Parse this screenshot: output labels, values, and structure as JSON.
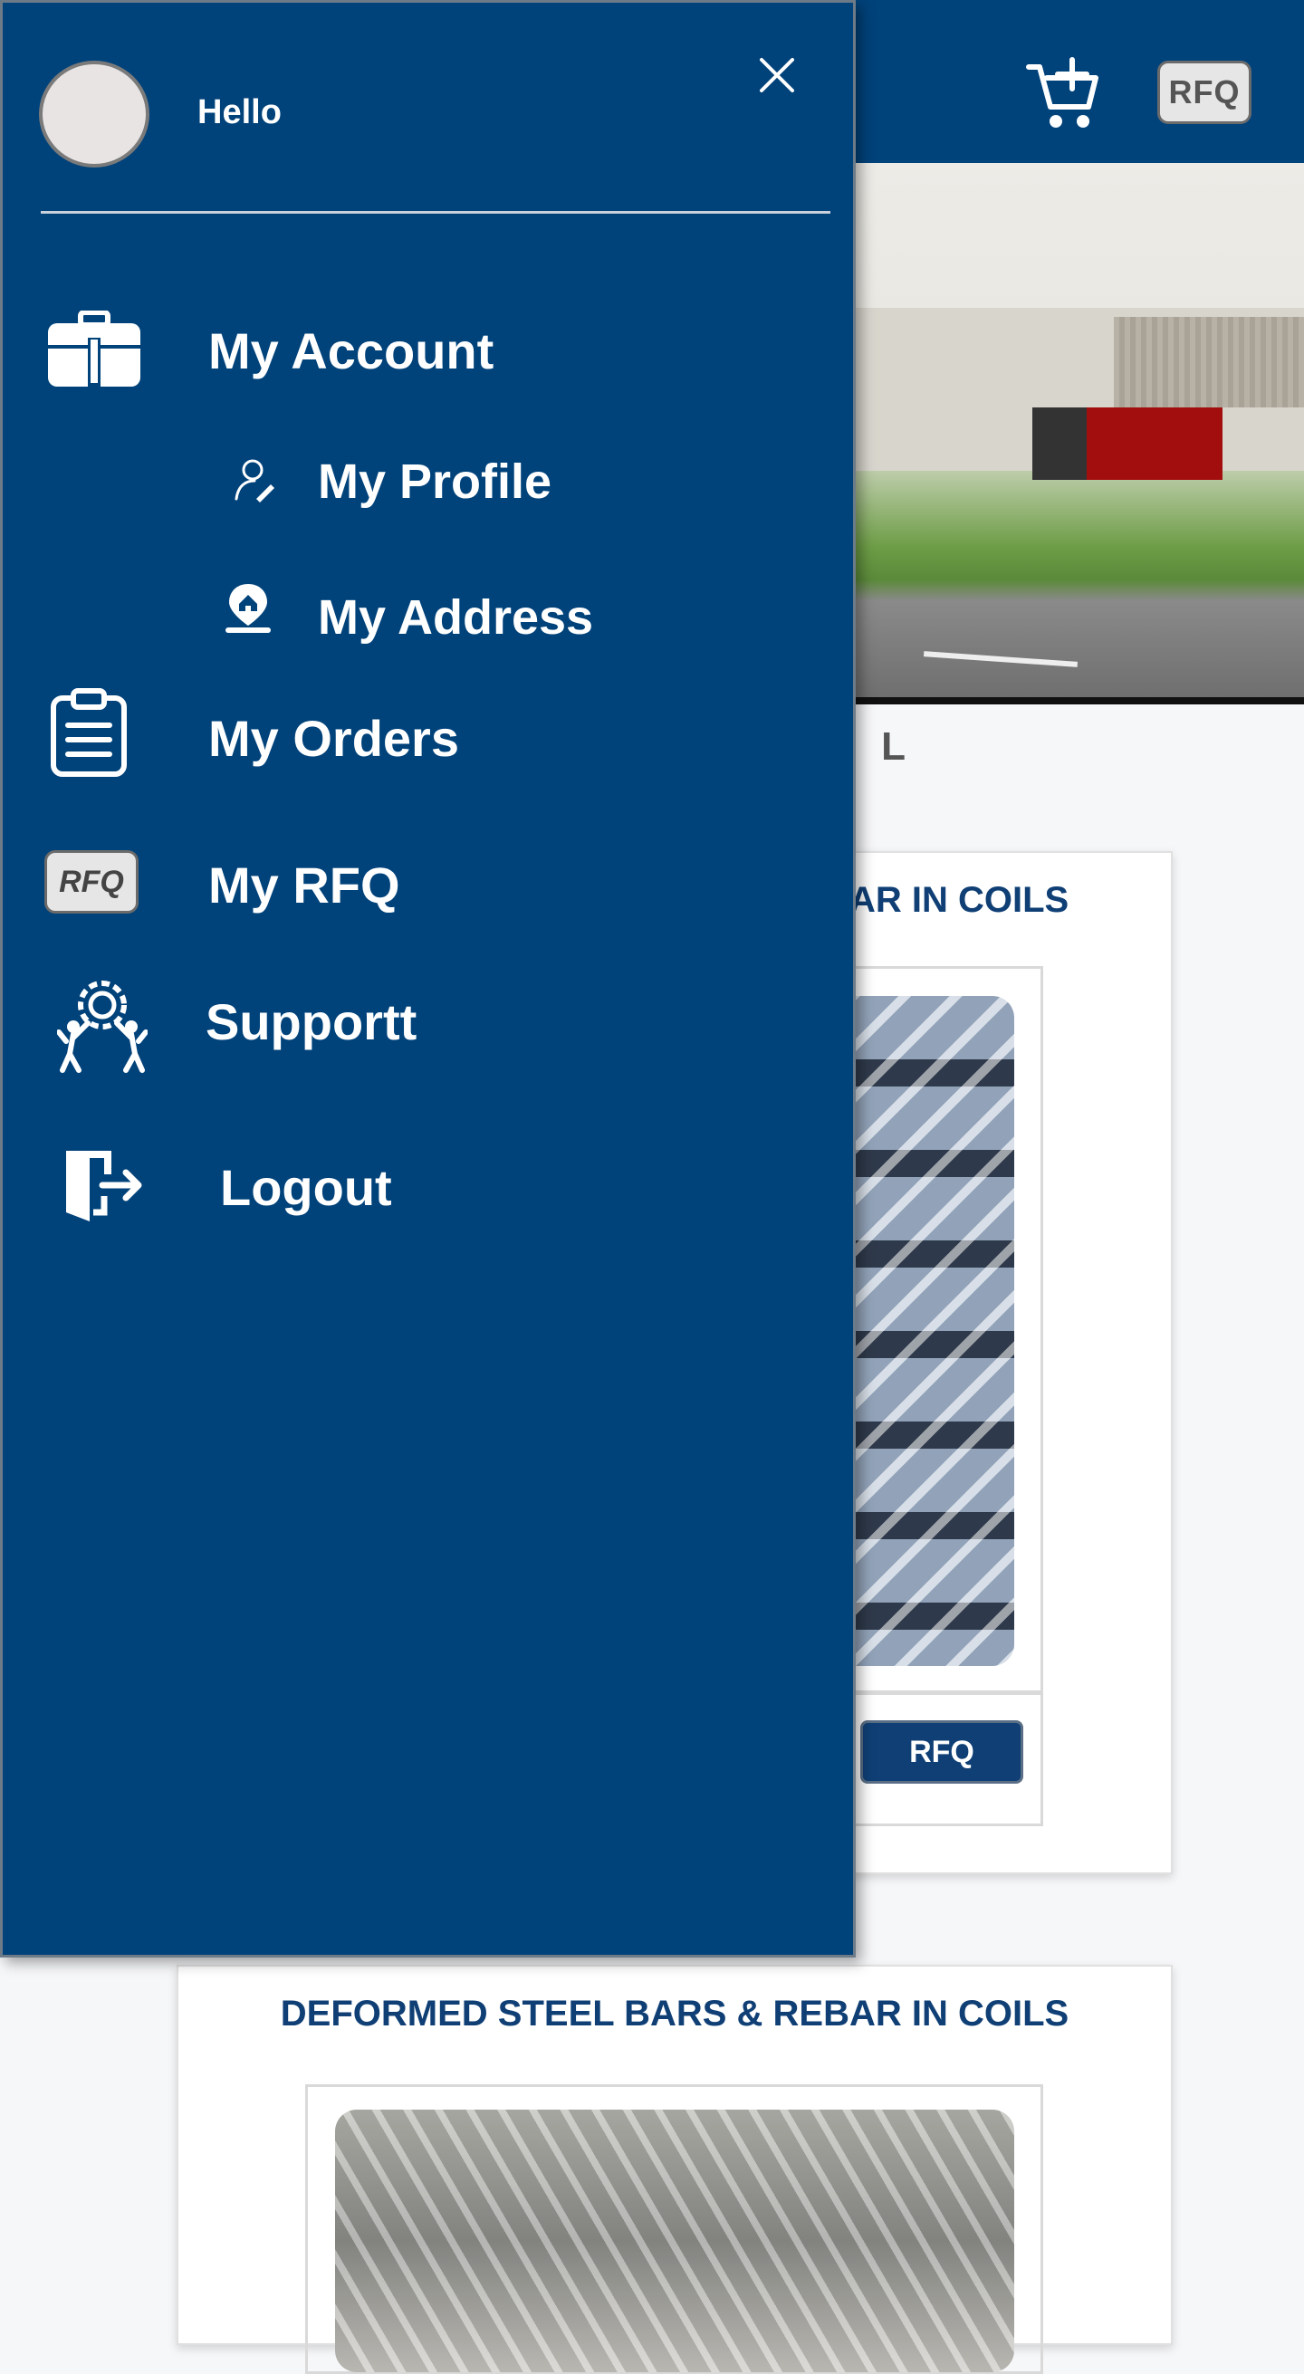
{
  "drawer": {
    "greeting": "Hello",
    "items": [
      {
        "label": "My Account",
        "icon": "briefcase-icon"
      },
      {
        "label": "My  Profile",
        "icon": "profile-edit-icon"
      },
      {
        "label": "My  Address",
        "icon": "location-pin-icon"
      },
      {
        "label": "My Orders",
        "icon": "clipboard-icon"
      },
      {
        "label": "My RFQ",
        "icon": "rfq-icon",
        "badge": "RFQ"
      },
      {
        "label": "Supportt",
        "icon": "support-gear-icon"
      },
      {
        "label": "Logout",
        "icon": "logout-door-icon"
      }
    ]
  },
  "header": {
    "rfq_label": "RFQ",
    "cart_icon": "cart-add-icon"
  },
  "main": {
    "section_heading": "L",
    "cards": [
      {
        "title": "DEFORMED STEEL BARS & REBAR IN COILS",
        "rfq_label": "RFQ"
      },
      {
        "title": "DEFORMED STEEL BARS & REBAR IN COILS"
      }
    ]
  },
  "colors": {
    "primary": "#00427a",
    "card_title": "#0f3f75",
    "page_bg": "#f6f7f9"
  }
}
